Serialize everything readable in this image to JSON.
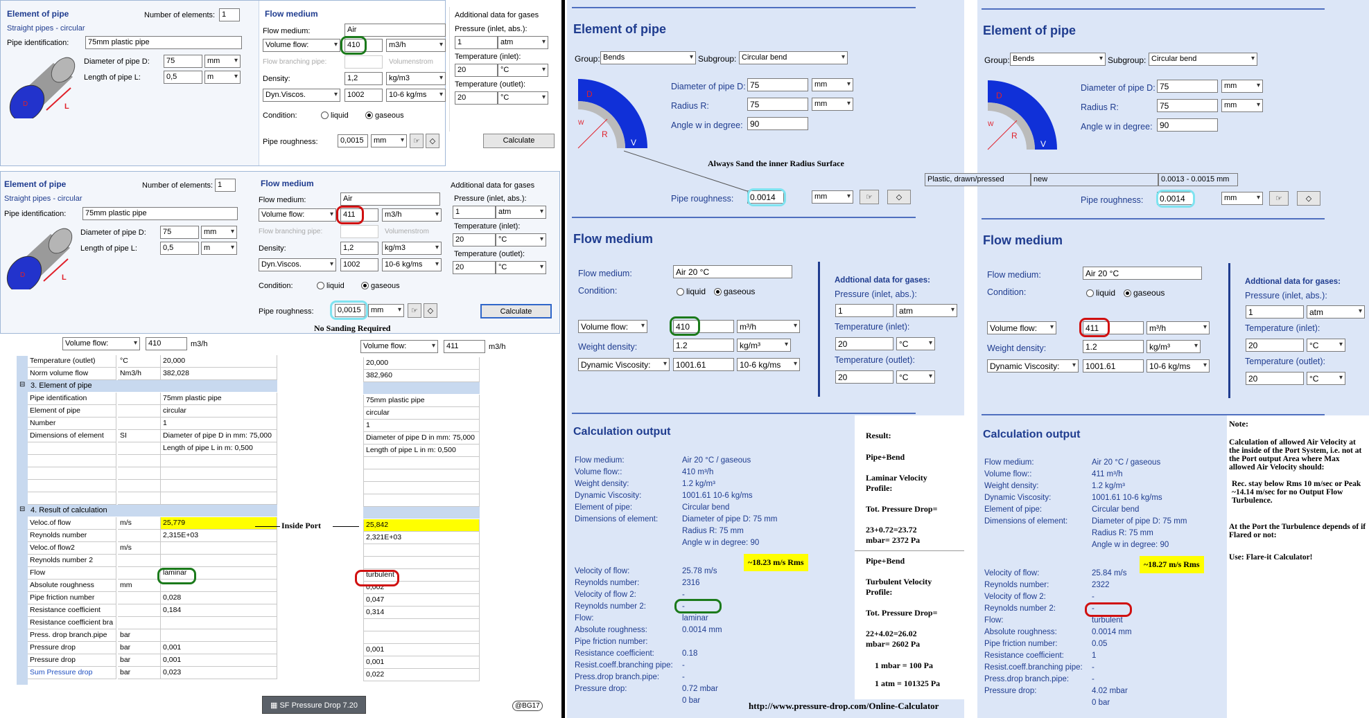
{
  "left_top": {
    "title": "Element of pipe",
    "num_label": "Number of elements:",
    "num_value": "1",
    "subtitle": "Straight pipes - circular",
    "pipe_id_label": "Pipe identification:",
    "pipe_id_value": "75mm plastic pipe",
    "diam_label": "Diameter of pipe D:",
    "diam_value": "75",
    "diam_unit": "mm",
    "len_label": "Length of pipe L:",
    "len_value": "0,5",
    "len_unit": "m",
    "flow_title": "Flow medium",
    "medium_label": "Flow medium:",
    "medium_value": "Air",
    "flow_select": "Volume flow:",
    "flow_value": "410",
    "flow_unit": "m3/h",
    "branch_label": "Flow branching pipe:",
    "branch_unit": "Volumenstrom",
    "density_label": "Density:",
    "density_value": "1,2",
    "density_unit": "kg/m3",
    "visc_select": "Dyn.Viscos.",
    "visc_value": "1002",
    "visc_unit": "10-6 kg/ms",
    "cond_label": "Condition:",
    "liquid": "liquid",
    "gaseous": "gaseous",
    "rough_label": "Pipe roughness:",
    "rough_value": "0,0015",
    "rough_unit": "mm",
    "calc": "Calculate",
    "gas_title": "Additional data for gases",
    "p_label": "Pressure (inlet, abs.):",
    "p_value": "1",
    "p_unit": "atm",
    "tin_label": "Temperature (inlet):",
    "tin_value": "20",
    "tin_unit": "°C",
    "tout_label": "Temperature (outlet):",
    "tout_value": "20",
    "tout_unit": "°C"
  },
  "left_mid": {
    "flow_value": "411",
    "note": "No Sanding Required"
  },
  "table": {
    "flow_select": "Volume flow:",
    "flow_a": "410",
    "flow_b": "411",
    "unit": "m3/h",
    "rows_top": [
      [
        "Temperature (outlet)",
        "°C",
        "20,000",
        "20,000"
      ],
      [
        "Norm volume flow",
        "Nm3/h",
        "382,028",
        "382,960"
      ]
    ],
    "sec3": "3. Element of pipe",
    "rows3": [
      [
        "Pipe identification",
        "",
        "75mm plastic pipe",
        "75mm plastic pipe"
      ],
      [
        "Element of pipe",
        "",
        "circular",
        "circular"
      ],
      [
        "Number",
        "",
        "1",
        "1"
      ],
      [
        "Dimensions of element",
        "SI",
        "Diameter of pipe D in mm: 75,000",
        "Diameter of pipe D in mm: 75,000"
      ],
      [
        "",
        "",
        "Length of pipe L in m: 0,500",
        "Length of pipe L in m: 0,500"
      ]
    ],
    "sec4": "4. Result of calculation",
    "rows4": [
      [
        "Veloc.of flow",
        "m/s",
        "25,779",
        "25,842"
      ],
      [
        "Reynolds number",
        "",
        "2,315E+03",
        "2,321E+03"
      ],
      [
        "Veloc.of flow2",
        "m/s",
        "",
        ""
      ],
      [
        "Reynolds number 2",
        "",
        "",
        ""
      ],
      [
        "Flow",
        "",
        "laminar",
        "turbulent"
      ],
      [
        "Absolute roughness",
        "mm",
        "",
        "0,002"
      ],
      [
        "Pipe friction number",
        "",
        "0,028",
        "0,047"
      ],
      [
        "Resistance coefficient",
        "",
        "0,184",
        "0,314"
      ],
      [
        "Resistance coefficient bra",
        "",
        "",
        ""
      ],
      [
        "Press. drop branch.pipe",
        "bar",
        "",
        ""
      ],
      [
        "Pressure drop",
        "bar",
        "0,001",
        "0,001"
      ],
      [
        "Pressure drop",
        "bar",
        "0,001",
        "0,001"
      ],
      [
        "Sum Pressure drop",
        "bar",
        "0,023",
        "0,022"
      ]
    ],
    "inside_port": "Inside Port",
    "taskbar": "SF Pressure Drop 7.20",
    "badge": "@BG17"
  },
  "bend": {
    "title": "Element of pipe",
    "group_label": "Group:",
    "group_value": "Bends",
    "subgroup_label": "Subgroup:",
    "subgroup_value": "Circular bend",
    "diam_label": "Diameter of pipe D:",
    "diam_value": "75",
    "diam_unit": "mm",
    "radius_label": "Radius R:",
    "radius_value": "75",
    "radius_unit": "mm",
    "angle_label": "Angle w in degree:",
    "angle_value": "90",
    "sand_note": "Always Sand the inner Radius Surface",
    "rough_label": "Pipe roughness:",
    "rough_value": "0.0014",
    "rough_unit": "mm",
    "flow_title": "Flow medium",
    "medium_label": "Flow medium:",
    "medium_value": "Air 20 °C",
    "cond_label": "Condition:",
    "liquid": "liquid",
    "gaseous": "gaseous",
    "vf_select": "Volume flow:",
    "vf_a": "410",
    "vf_b": "411",
    "vf_unit": "m³/h",
    "wd_label": "Weight density:",
    "wd_value": "1.2",
    "wd_unit": "kg/m³",
    "dv_select": "Dynamic Viscosity:",
    "dv_value": "1001.61",
    "dv_unit": "10-6 kg/ms",
    "gas_title": "Addtional data for gases:",
    "p_label": "Pressure (inlet, abs.):",
    "p_value": "1",
    "p_unit": "atm",
    "tin_label": "Temperature (inlet):",
    "tin_value": "20",
    "tin_unit": "°C",
    "tout_label": "Temperature (outlet):",
    "tout_value": "20",
    "tout_unit": "°C",
    "mat_a": "Plastic, drawn/pressed",
    "mat_b": "new",
    "mat_c": "0.0013 - 0.0015 mm"
  },
  "calc_a": {
    "title": "Calculation output",
    "rows": [
      [
        "Flow medium:",
        "Air 20 °C / gaseous"
      ],
      [
        "Volume flow::",
        "410 m³/h"
      ],
      [
        "Weight density:",
        "1.2 kg/m³"
      ],
      [
        "Dynamic Viscosity:",
        "1001.61 10-6 kg/ms"
      ],
      [
        "Element of pipe:",
        "Circular bend"
      ],
      [
        "Dimensions of element:",
        "Diameter of pipe D: 75 mm"
      ],
      [
        "",
        "Radius R: 75 mm"
      ],
      [
        "",
        "Angle w in degree: 90"
      ]
    ],
    "rows2": [
      [
        "Velocity of flow:",
        "25.78 m/s"
      ],
      [
        "Reynolds number:",
        "2316"
      ],
      [
        "Velocity of flow 2:",
        "-"
      ],
      [
        "Reynolds number 2:",
        "-"
      ],
      [
        "Flow:",
        "laminar"
      ],
      [
        "Absolute roughness:",
        "0.0014 mm"
      ],
      [
        "Pipe friction number:",
        ""
      ],
      [
        "Resistance coefficient:",
        "0.18"
      ],
      [
        "Resist.coeff.branching pipe:",
        "-"
      ],
      [
        "Press.drop branch.pipe:",
        "-"
      ],
      [
        "Pressure drop:",
        "0.72 mbar"
      ],
      [
        "",
        "0 bar"
      ]
    ],
    "rms": "~18.23 m/s Rms"
  },
  "calc_b": {
    "title": "Calculation output",
    "rows": [
      [
        "Flow medium:",
        "Air 20 °C / gaseous"
      ],
      [
        "Volume flow::",
        "411 m³/h"
      ],
      [
        "Weight density:",
        "1.2 kg/m³"
      ],
      [
        "Dynamic Viscosity:",
        "1001.61 10-6 kg/ms"
      ],
      [
        "Element of pipe:",
        "Circular bend"
      ],
      [
        "Dimensions of element:",
        "Diameter of pipe D: 75 mm"
      ],
      [
        "",
        "Radius R: 75 mm"
      ],
      [
        "",
        "Angle w in degree: 90"
      ]
    ],
    "rows2": [
      [
        "Velocity of flow:",
        "25.84 m/s"
      ],
      [
        "Reynolds number:",
        "2322"
      ],
      [
        "Velocity of flow 2:",
        "-"
      ],
      [
        "Reynolds number 2:",
        "-"
      ],
      [
        "Flow:",
        "turbulent"
      ],
      [
        "Absolute roughness:",
        "0.0014 mm"
      ],
      [
        "Pipe friction number:",
        "0.05"
      ],
      [
        "Resistance coefficient:",
        "1"
      ],
      [
        "Resist.coeff.branching pipe:",
        "-"
      ],
      [
        "Press.drop branch.pipe:",
        "-"
      ],
      [
        "Pressure drop:",
        "4.02 mbar"
      ],
      [
        "",
        "0 bar"
      ]
    ],
    "rms": "~18.27 m/s Rms"
  },
  "result": {
    "r1": "Result:",
    "r2": "Pipe+Bend",
    "r3": "Laminar Velocity Profile:",
    "r4": "Tot. Pressure Drop=",
    "r5": "23+0.72=23.72 mbar= 2372 Pa",
    "r6": "Pipe+Bend",
    "r7": "Turbulent Velocity Profile:",
    "r8": "Tot. Pressure Drop=",
    "r9": "22+4.02=26.02 mbar= 2602 Pa",
    "r10": "1 mbar = 100 Pa",
    "r11": "1 atm = 101325 Pa"
  },
  "note": {
    "n1": "Note:",
    "n2": "Calculation of allowed Air Velocity at the inside of the Port System, i.e. not at the Port output Area where Max allowed Air Velocity should:",
    "n3": "Rec. stay below Rms 10 m/sec or Peak ~14.14 m/sec for no Output Flow Turbulence.",
    "n4": "At the Port the Turbulence depends of if Flared or not:",
    "n5": "Use: Flare-it Calculator!"
  },
  "url": "http://www.pressure-drop.com/Online-Calculator"
}
